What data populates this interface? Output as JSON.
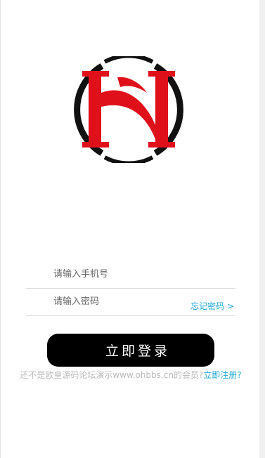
{
  "logo": {
    "name": "HN-logo",
    "colors": {
      "ring": "#111111",
      "letters": "#e0101b"
    }
  },
  "login_form": {
    "phone_placeholder": "请输入手机号",
    "password_placeholder": "请输入密码",
    "forgot_password_label": "忘记密码 >",
    "login_button_label": "立即登录"
  },
  "register_prompt": {
    "text": "还不是欧皇源码论坛演示www.ohbbs.cn的会员?",
    "link_label": "立即注册?"
  },
  "colors": {
    "accent": "#1ea7d6",
    "button_bg": "#000000",
    "muted_text": "#b9b9b9"
  }
}
